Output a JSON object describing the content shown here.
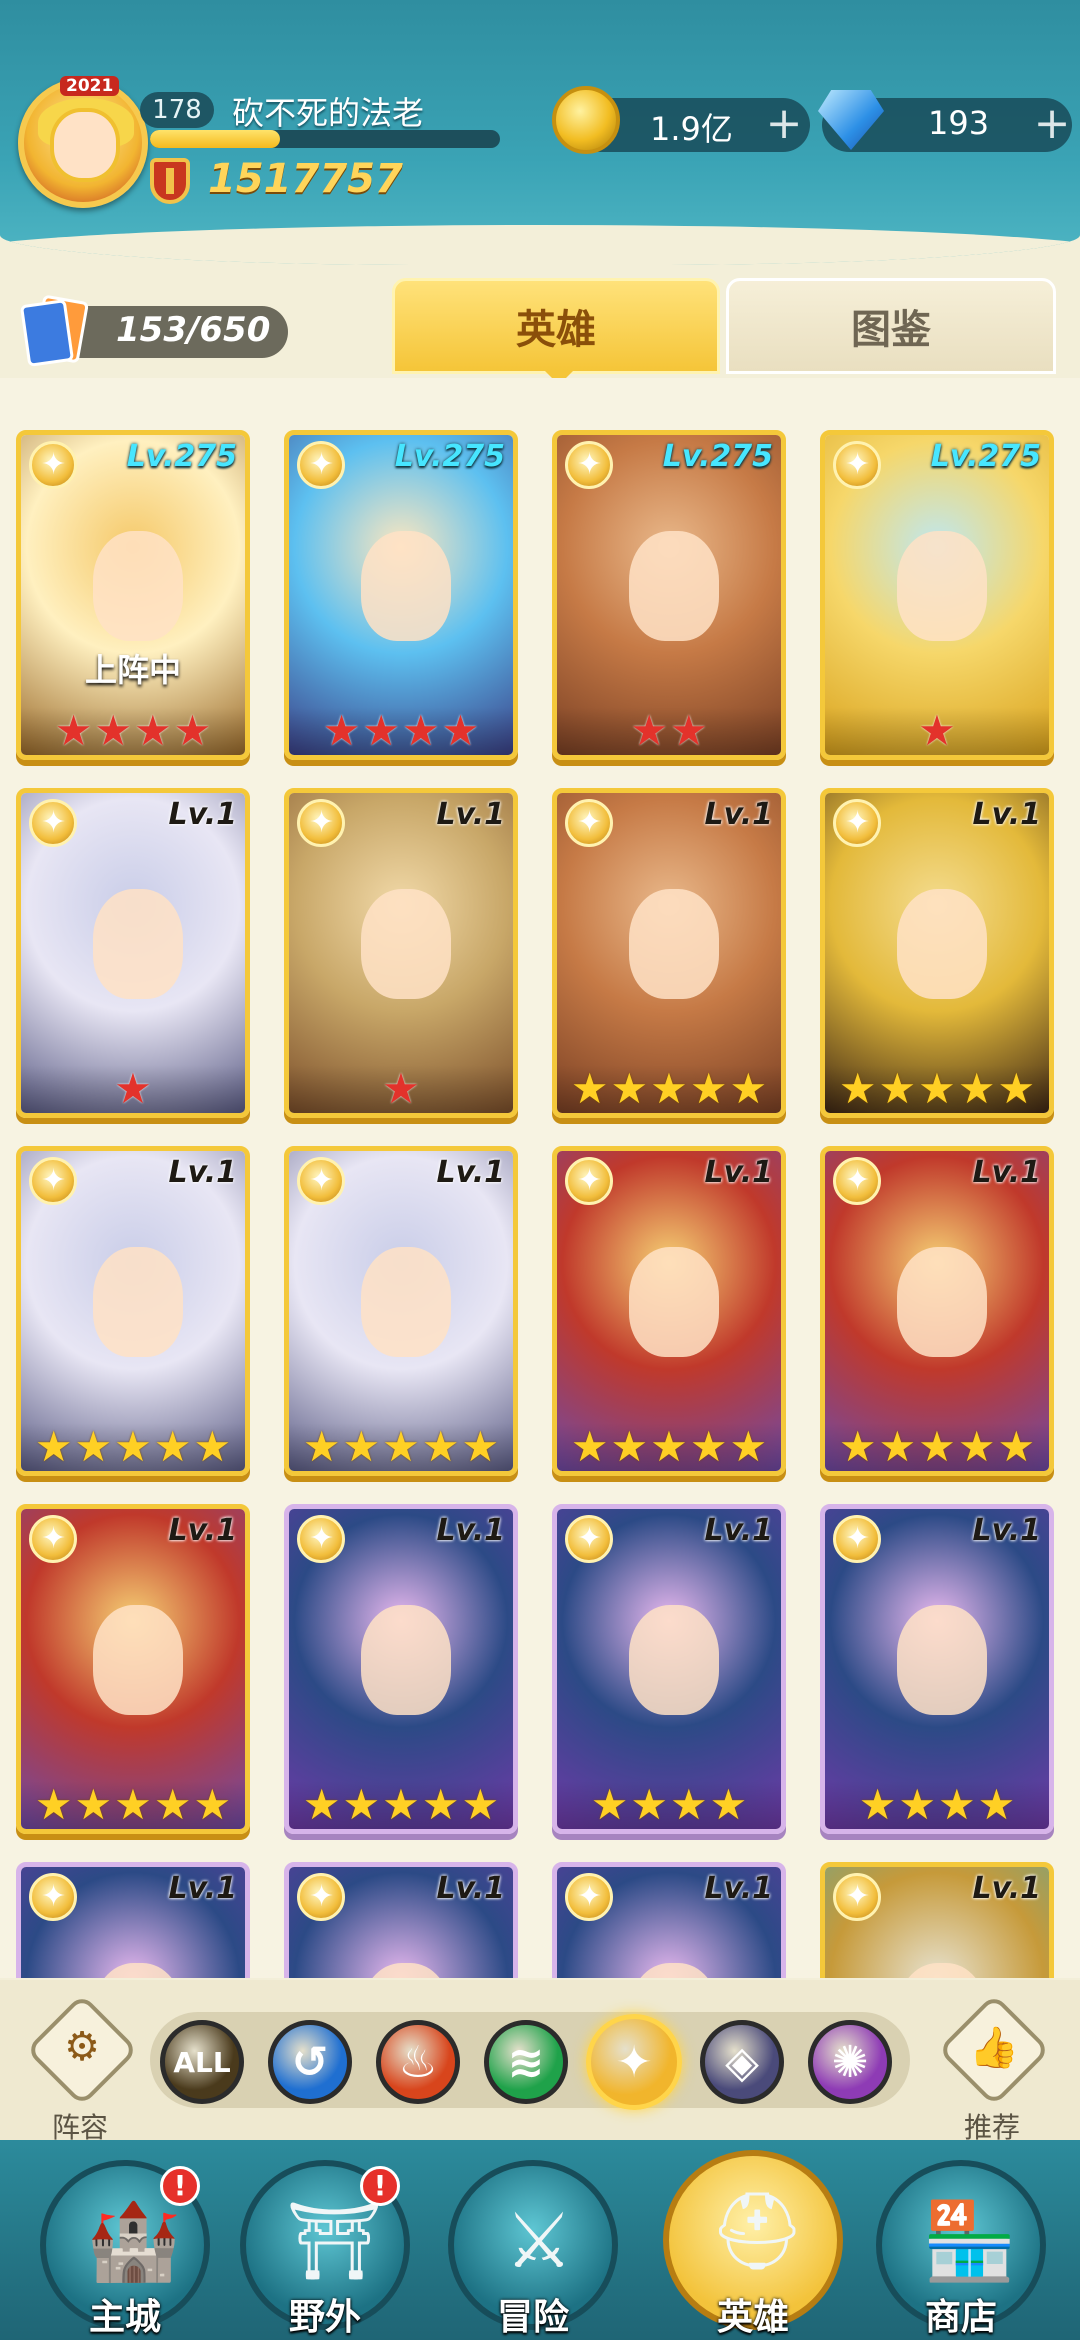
{
  "header": {
    "avatar_year": "2021",
    "player_level": "178",
    "player_name": "砍不死的法老",
    "xp_progress": 0.37,
    "power": "1517757",
    "gold": "1.9亿",
    "gems": "193",
    "plus": "+"
  },
  "collection": {
    "count": "153/650"
  },
  "tabs": [
    {
      "label": "英雄",
      "selected": true
    },
    {
      "label": "图鉴",
      "selected": false
    }
  ],
  "heroes": [
    {
      "level": "Lv.275",
      "stars": 4,
      "star_color": "red",
      "status": "上阵中",
      "theme": "gold"
    },
    {
      "level": "Lv.275",
      "stars": 4,
      "star_color": "red",
      "status": "",
      "theme": "gold"
    },
    {
      "level": "Lv.275",
      "stars": 2,
      "star_color": "red",
      "status": "",
      "theme": "gold"
    },
    {
      "level": "Lv.275",
      "stars": 1,
      "star_color": "red",
      "status": "",
      "theme": "gold"
    },
    {
      "level": "Lv.1",
      "stars": 1,
      "star_color": "red",
      "status": "",
      "theme": "gold"
    },
    {
      "level": "Lv.1",
      "stars": 1,
      "star_color": "red",
      "status": "",
      "theme": "gold"
    },
    {
      "level": "Lv.1",
      "stars": 5,
      "star_color": "gold",
      "status": "",
      "theme": "gold"
    },
    {
      "level": "Lv.1",
      "stars": 5,
      "star_color": "gold",
      "status": "",
      "theme": "gold"
    },
    {
      "level": "Lv.1",
      "stars": 5,
      "star_color": "gold",
      "status": "",
      "theme": "gold"
    },
    {
      "level": "Lv.1",
      "stars": 5,
      "star_color": "gold",
      "status": "",
      "theme": "gold"
    },
    {
      "level": "Lv.1",
      "stars": 5,
      "star_color": "gold",
      "status": "",
      "theme": "gold"
    },
    {
      "level": "Lv.1",
      "stars": 5,
      "star_color": "gold",
      "status": "",
      "theme": "gold"
    },
    {
      "level": "Lv.1",
      "stars": 5,
      "star_color": "gold",
      "status": "",
      "theme": "gold"
    },
    {
      "level": "Lv.1",
      "stars": 5,
      "star_color": "gold",
      "status": "",
      "theme": "purple"
    },
    {
      "level": "Lv.1",
      "stars": 4,
      "star_color": "gold",
      "status": "",
      "theme": "purple"
    },
    {
      "level": "Lv.1",
      "stars": 4,
      "star_color": "gold",
      "status": "",
      "theme": "purple"
    },
    {
      "level": "Lv.1",
      "stars": 0,
      "star_color": "gold",
      "status": "",
      "theme": "purple"
    },
    {
      "level": "Lv.1",
      "stars": 0,
      "star_color": "gold",
      "status": "",
      "theme": "purple"
    },
    {
      "level": "Lv.1",
      "stars": 0,
      "star_color": "gold",
      "status": "",
      "theme": "purple"
    },
    {
      "level": "Lv.1",
      "stars": 0,
      "star_color": "gold",
      "status": "",
      "theme": "gold"
    }
  ],
  "filters": {
    "left_label": "阵容",
    "right_label": "推荐",
    "items": [
      {
        "label": "ALL",
        "color": "#4a3a1c"
      },
      {
        "label": "",
        "color": "#1f6fd1"
      },
      {
        "label": "",
        "color": "#d8451c"
      },
      {
        "label": "",
        "color": "#1fa24a"
      },
      {
        "label": "",
        "color": "#f1b52c"
      },
      {
        "label": "",
        "color": "#4a4a7a"
      },
      {
        "label": "",
        "color": "#8e3bb5"
      }
    ],
    "selected_index": 4
  },
  "nav": [
    {
      "label": "主城",
      "icon": "castle-icon",
      "alert": true
    },
    {
      "label": "野外",
      "icon": "portal-icon",
      "alert": true
    },
    {
      "label": "冒险",
      "icon": "sword-icon",
      "alert": false
    },
    {
      "label": "英雄",
      "icon": "knight-helmet-icon",
      "alert": false,
      "active": true
    },
    {
      "label": "商店",
      "icon": "shop-icon",
      "alert": false
    }
  ],
  "alert_symbol": "!"
}
